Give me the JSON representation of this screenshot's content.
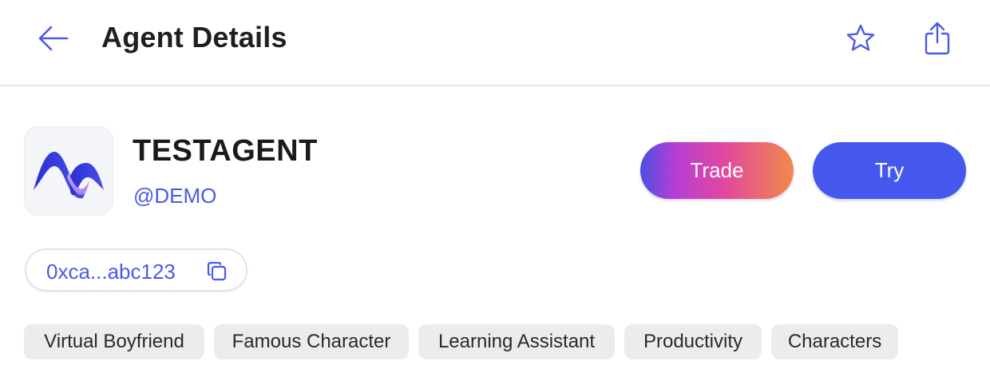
{
  "header": {
    "title": "Agent Details",
    "icons": [
      "arrow-left-icon",
      "star-icon",
      "share-icon"
    ]
  },
  "agent": {
    "name": "TESTAGENT",
    "handle": "@DEMO",
    "address": "0xca...abc123",
    "logo": "wave-logo"
  },
  "actions": {
    "trade_label": "Trade",
    "try_label": "Try"
  },
  "tags": [
    "Virtual Boyfriend",
    "Famous Character",
    "Learning Assistant",
    "Productivity",
    "Characters"
  ],
  "colors": {
    "accent": "#4458ee",
    "link": "#4a5ae8",
    "trade_gradient": [
      "#4a4fe0",
      "#b33fd6",
      "#e3479e",
      "#f08a4a"
    ],
    "tag_bg": "#ececee"
  }
}
